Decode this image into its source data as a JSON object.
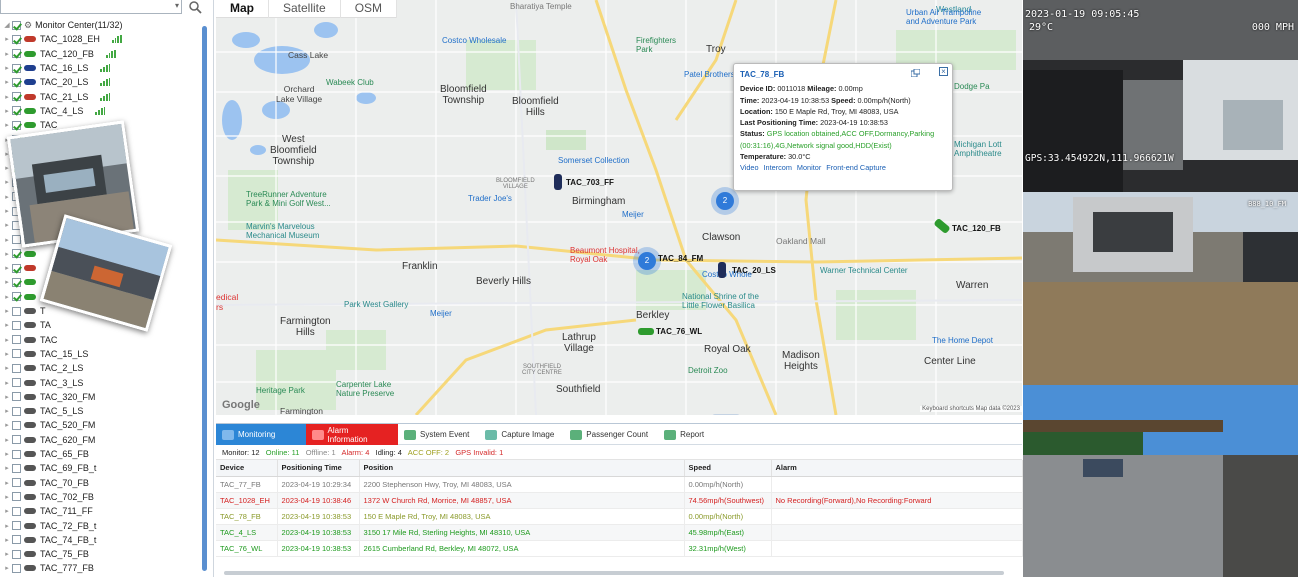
{
  "tree": {
    "root_label": "Monitor Center(11/32)",
    "items": [
      {
        "label": "TAC_1028_EH",
        "checked": true,
        "color": "#c0392b",
        "signal": true
      },
      {
        "label": "TAC_120_FB",
        "checked": true,
        "color": "#2e9b2e",
        "signal": true
      },
      {
        "label": "TAC_16_LS",
        "checked": true,
        "color": "#1f3f8f",
        "signal": true
      },
      {
        "label": "TAC_20_LS",
        "checked": true,
        "color": "#1f3f8f",
        "signal": true
      },
      {
        "label": "TAC_21_LS",
        "checked": true,
        "color": "#c0392b",
        "signal": true
      },
      {
        "label": "TAC_4_LS",
        "checked": true,
        "color": "#2e9b2e",
        "signal": true
      },
      {
        "label": "TAC_",
        "checked": true,
        "color": "#2e9b2e",
        "signal": false
      },
      {
        "label": "",
        "checked": true,
        "color": "#c0392b",
        "signal": false
      },
      {
        "label": "",
        "checked": true,
        "color": "#2e9b2e",
        "signal": false
      },
      {
        "label": "",
        "checked": true,
        "color": "#2e9b2e",
        "signal": false
      },
      {
        "label": "",
        "checked": false,
        "color": "#555",
        "signal": false
      },
      {
        "label": "",
        "checked": false,
        "color": "#555",
        "signal": false
      },
      {
        "label": "",
        "checked": false,
        "color": "#555",
        "signal": false
      },
      {
        "label": "",
        "checked": false,
        "color": "#555",
        "signal": false
      },
      {
        "label": "",
        "checked": false,
        "color": "#555",
        "signal": false
      },
      {
        "label": "",
        "checked": true,
        "color": "#2e9b2e",
        "signal": false
      },
      {
        "label": "",
        "checked": true,
        "color": "#c0392b",
        "signal": false
      },
      {
        "label": "",
        "checked": true,
        "color": "#2e9b2e",
        "signal": false
      },
      {
        "label": "",
        "checked": true,
        "color": "#2e9b2e",
        "signal": false
      },
      {
        "label": "T",
        "checked": false,
        "color": "#555",
        "signal": false
      },
      {
        "label": "TA",
        "checked": false,
        "color": "#555",
        "signal": false
      },
      {
        "label": "TAC",
        "checked": false,
        "color": "#555",
        "signal": false
      },
      {
        "label": "TAC_15_LS",
        "checked": false,
        "color": "#555",
        "signal": false
      },
      {
        "label": "TAC_2_LS",
        "checked": false,
        "color": "#555",
        "signal": false
      },
      {
        "label": "TAC_3_LS",
        "checked": false,
        "color": "#555",
        "signal": false
      },
      {
        "label": "TAC_320_FM",
        "checked": false,
        "color": "#555",
        "signal": false
      },
      {
        "label": "TAC_5_LS",
        "checked": false,
        "color": "#555",
        "signal": false
      },
      {
        "label": "TAC_520_FM",
        "checked": false,
        "color": "#555",
        "signal": false
      },
      {
        "label": "TAC_620_FM",
        "checked": false,
        "color": "#555",
        "signal": false
      },
      {
        "label": "TAC_65_FB",
        "checked": false,
        "color": "#555",
        "signal": false
      },
      {
        "label": "TAC_69_FB_t",
        "checked": false,
        "color": "#555",
        "signal": false
      },
      {
        "label": "TAC_70_FB",
        "checked": false,
        "color": "#555",
        "signal": false
      },
      {
        "label": "TAC_702_FB",
        "checked": false,
        "color": "#555",
        "signal": false
      },
      {
        "label": "TAC_711_FF",
        "checked": false,
        "color": "#555",
        "signal": false
      },
      {
        "label": "TAC_72_FB_t",
        "checked": false,
        "color": "#555",
        "signal": false
      },
      {
        "label": "TAC_74_FB_t",
        "checked": false,
        "color": "#555",
        "signal": false
      },
      {
        "label": "TAC_75_FB",
        "checked": false,
        "color": "#555",
        "signal": false
      },
      {
        "label": "TAC_777_FB",
        "checked": false,
        "color": "#555",
        "signal": false
      }
    ]
  },
  "map": {
    "tabs": [
      "Map",
      "Satellite",
      "OSM"
    ],
    "active_tab": "Map",
    "google": "Google",
    "footer": "Keyboard shortcuts   Map data ©2023",
    "places": {
      "westland": "Westland",
      "troy": "Troy",
      "bloomfield_hills": "Bloomfield\nHills",
      "bloomfield": "Bloomfield\nTownship",
      "west_bloomfield": "West\nBloomfield\nTownship",
      "birmingham": "Birmingham",
      "clawson": "Clawson",
      "franklin": "Franklin",
      "beverly_hills": "Beverly Hills",
      "farmington_hills": "Farmington\nHills",
      "berkley": "Berkley",
      "royal_oak": "Royal Oak",
      "madison_heights": "Madison\nHeights",
      "warren": "Warren",
      "center_line": "Center Line",
      "southfield": "Southfield",
      "lathrup": "Lathrup\nVillage",
      "orchard_lake": "Orchard\nLake Village",
      "cass_lake": "Cass Lake",
      "farmington": "Farmington",
      "medical": "edical\nrs",
      "bloomfield_village": "BLOOMFIELD\nVILLAGE",
      "southfield_city": "SOUTHFIELD\nCITY CENTRE",
      "oakland_mall": "Oakland Mall"
    },
    "pois": {
      "costco1": "Costco Wholesale",
      "costco2": "Costco Whole",
      "firefighters": "Firefighters\nPark",
      "patel": "Patel Brothers",
      "wabeek": "Wabeek Club",
      "somerset": "Somerset Collection",
      "treerunner": "TreeRunner Adventure\nPark & Mini Golf West...",
      "marvins": "Marvin's Marvelous\nMechanical Museum",
      "traderjoes": "Trader Joe's",
      "meijer1": "Meijer",
      "meijer2": "Meijer",
      "beaumont": "Beaumont Hospital,\nRoyal Oak",
      "shrine": "National Shrine of the\nLittle Flower Basilica",
      "warner": "Warner Technical Center",
      "parkwest": "Park West Gallery",
      "detroitzoo": "Detroit Zoo",
      "homedepot": "The Home Depot",
      "heritage": "Heritage Park",
      "carpenter": "Carpenter Lake\nNature Preserve",
      "dodge": "Dodge Pa",
      "michigan": "Michigan Lott\nAmphitheatre",
      "urban": "Urban Air Trampoline\nand Adventure Park",
      "bharatiya": "Bharatiya Temple"
    },
    "vehicles": {
      "v703": "TAC_703_FF",
      "v120": "TAC_120_FB",
      "v84": "TAC_84_FM",
      "v20": "TAC_20_LS",
      "v76": "TAC_76_WL"
    },
    "clusters": {
      "c1": "2",
      "c2": "2"
    }
  },
  "popup": {
    "title": "TAC_78_FB",
    "device_id_label": "Device ID:",
    "device_id": "0011018",
    "mileage_label": "Mileage:",
    "mileage": "0.00mp",
    "time_label": "Time:",
    "time": "2023-04-19 10:38:53",
    "speed_label": "Speed:",
    "speed": "0.00mp/h(North)",
    "location_label": "Location:",
    "location": "150 E Maple Rd, Troy, MI 48083, USA",
    "last_pos_label": "Last Positioning Time:",
    "last_pos": "2023-04-19 10:38:53",
    "status_label": "Status:",
    "status": "GPS location obtained,ACC OFF,Dormancy,Parking (00:31:16),4G,Network signal good,HDD(Exist)",
    "temp_label": "Temperature:",
    "temp": "30.0°C",
    "links": [
      "Video",
      "Intercom",
      "Monitor",
      "Front-end Capture"
    ]
  },
  "bottom": {
    "tabs": [
      {
        "label": "Monitoring",
        "color": "#2c86d6"
      },
      {
        "label": "Alarm Information",
        "color": "#e52222"
      },
      {
        "label": "System Event",
        "color": "#3aa05a"
      },
      {
        "label": "Capture Image",
        "color": "#3aa08a"
      },
      {
        "label": "Passenger Count",
        "color": "#3aa05a"
      },
      {
        "label": "Report",
        "color": "#3aa05a"
      }
    ],
    "stats": {
      "monitor_label": "Monitor:",
      "monitor": "12",
      "online_label": "Online:",
      "online": "11",
      "offline_label": "Offline:",
      "offline": "1",
      "alarm_label": "Alarm:",
      "alarm": "4",
      "idling_label": "Idling:",
      "idling": "4",
      "accoff_label": "ACC OFF:",
      "accoff": "2",
      "gpsinv_label": "GPS Invalid:",
      "gpsinv": "1"
    },
    "columns": [
      "Device",
      "Positioning Time",
      "Position",
      "Speed",
      "Alarm"
    ],
    "rows": [
      {
        "device": "TAC_77_FB",
        "time": "2023-04-19 10:29:34",
        "position": "2200 Stephenson Hwy, Troy, MI 48083, USA",
        "speed": "0.00mp/h(North)",
        "alarm": "",
        "cls": "gray"
      },
      {
        "device": "TAC_1028_EH",
        "time": "2023-04-19 10:38:46",
        "position": "1372 W Church Rd, Morrice, MI 48857, USA",
        "speed": "74.56mp/h(Southwest)",
        "alarm": "No Recording(Forward),No Recording:Forward",
        "cls": "red"
      },
      {
        "device": "TAC_78_FB",
        "time": "2023-04-19 10:38:53",
        "position": "150 E Maple Rd, Troy, MI 48083, USA",
        "speed": "0.00mp/h(North)",
        "alarm": "",
        "cls": "olive"
      },
      {
        "device": "TAC_4_LS",
        "time": "2023-04-19 10:38:53",
        "position": "3150 17 Mile Rd, Sterling Heights, MI 48310, USA",
        "speed": "45.98mp/h(East)",
        "alarm": "",
        "cls": "green"
      },
      {
        "device": "TAC_76_WL",
        "time": "2023-04-19 10:38:53",
        "position": "2615 Cumberland Rd, Berkley, MI 48072, USA",
        "speed": "32.31mp/h(West)",
        "alarm": "",
        "cls": "green"
      }
    ]
  },
  "cams": {
    "cam1_time": "2023-01-19 09:05:45",
    "cam1_temp": "29°C",
    "cam1_speed": "000 MPH",
    "cam1_gps": "GPS:33.454922N,111.966621W",
    "cam2_label": "B88_10_FM"
  }
}
